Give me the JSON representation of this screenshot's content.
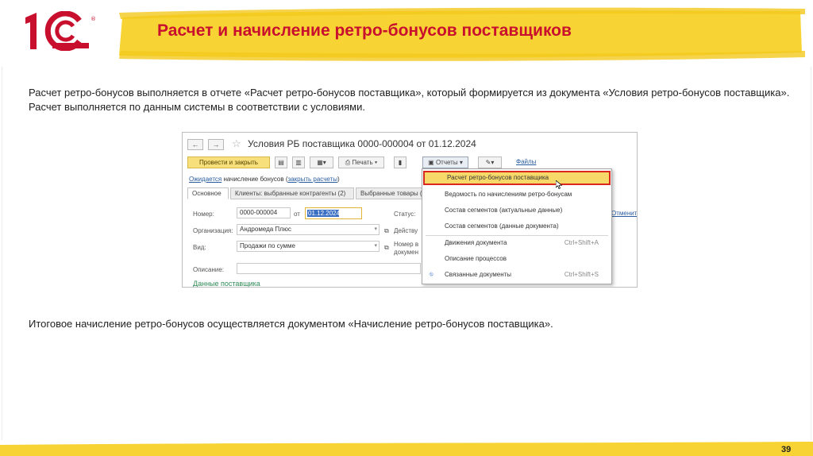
{
  "header": {
    "logo_text": "1С",
    "logo_mark": "®",
    "title": "Расчет и начисление ретро-бонусов поставщиков"
  },
  "intro_text": "Расчет ретро-бонусов выполняется в отчете «Расчет ретро-бонусов поставщика», который формируется из документа «Условия ретро-бонусов поставщика». Расчет выполняется по данным системы в соответствии с условиями.",
  "bottom_text": "Итоговое начисление ретро-бонусов осуществляется документом «Начисление ретро-бонусов поставщика».",
  "page_number": "39",
  "colors": {
    "brand_red": "#c8102e",
    "accent_yellow": "#f7d434",
    "highlight_red": "#d9281e"
  },
  "screenshot": {
    "nav": {
      "back": "←",
      "forward": "→",
      "favorite_icon": "star-icon"
    },
    "doc_title": "Условия РБ поставщика 0000-000004 от 01.12.2024",
    "toolbar": {
      "post_and_close": "Провести и закрыть",
      "print": "Печать",
      "reports": "Отчеты",
      "files": "Файлы"
    },
    "link_row": {
      "status": "Ожидается",
      "middle": " начисление бонусов (",
      "link": "закрыть расчеты",
      "end": ")"
    },
    "tabs": [
      "Основное",
      "Клиенты: выбранные контрагенты (2)",
      "Выбранные товары (2"
    ],
    "fields": {
      "number_label": "Номер:",
      "number_value": "0000-000004",
      "date_from_label": "от",
      "date_value": "01.12.2024",
      "status_label": "Статус:",
      "org_label": "Организация:",
      "org_value": "Андромеда Плюс",
      "valid_label": "Действу",
      "kind_label": "Вид:",
      "kind_value": "Продажи по сумме",
      "contract_label_1": "Номер в",
      "contract_label_2": "докумен",
      "desc_label": "Описание:",
      "right_link": "Отменит"
    },
    "supplier_link": "Данные поставщика",
    "menu": {
      "items": [
        {
          "label": "Расчет ретро-бонусов поставщика",
          "shortcut": ""
        },
        {
          "label": "Ведомость по начислениям ретро-бонусам",
          "shortcut": ""
        },
        {
          "label": "Состав сегментов (актуальные данные)",
          "shortcut": ""
        },
        {
          "label": "Состав сегментов (данные документа)",
          "shortcut": ""
        },
        {
          "label": "Движения документа",
          "shortcut": "Ctrl+Shift+A"
        },
        {
          "label": "Описание процессов",
          "shortcut": ""
        },
        {
          "label": "Связанные документы",
          "shortcut": "Ctrl+Shift+S"
        }
      ]
    }
  }
}
